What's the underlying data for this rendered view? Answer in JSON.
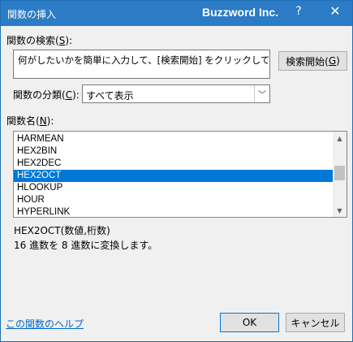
{
  "window": {
    "title": "関数の挿入",
    "brand": "Buzzword Inc.",
    "help_glyph": "?",
    "close_glyph": "✕"
  },
  "search": {
    "label_prefix": "関数の検索(",
    "label_key": "S",
    "label_suffix": "):",
    "value": "何がしたいかを簡単に入力して、[検索開始] をクリックしてください。",
    "button_prefix": "検索開始(",
    "button_key": "G",
    "button_suffix": ")"
  },
  "category": {
    "label_prefix": "関数の分類(",
    "label_key": "C",
    "label_suffix": "):",
    "value": "すべて表示",
    "arrow_glyph": "﹀"
  },
  "function_list": {
    "label_prefix": "関数名(",
    "label_key": "N",
    "label_suffix": "):",
    "items": [
      "HARMEAN",
      "HEX2BIN",
      "HEX2DEC",
      "HEX2OCT",
      "HLOOKUP",
      "HOUR",
      "HYPERLINK"
    ],
    "selected_index": 3,
    "scroll_up_glyph": "▲",
    "scroll_down_glyph": "▼"
  },
  "details": {
    "syntax": "HEX2OCT(数値,桁数)",
    "description": "16 進数を 8 進数に変換します。"
  },
  "footer": {
    "help_link": "この関数のヘルプ",
    "ok_label": "OK",
    "cancel_label": "キャンセル"
  },
  "colors": {
    "titlebar": "#2b7bc6",
    "selection": "#0078d7",
    "link": "#0066cc"
  }
}
